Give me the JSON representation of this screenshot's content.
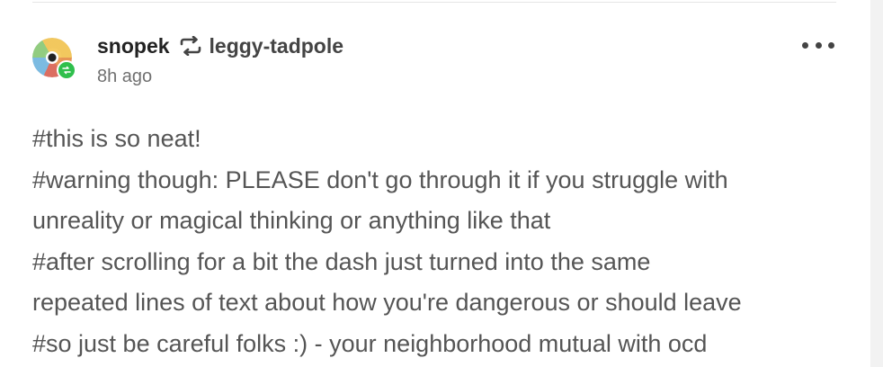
{
  "post": {
    "author": "snopek",
    "reblogged_from": "leggy-tadpole",
    "timestamp": "8h ago",
    "tags": [
      "#this is so neat!",
      "#warning though: PLEASE don't go through it if you struggle with",
      "unreality or magical thinking or anything like that",
      "#after scrolling for a bit the dash just turned into the same",
      "repeated lines of text about how you're dangerous or should leave",
      "#so just be careful folks :) - your neighborhood mutual with ocd"
    ]
  },
  "icons": {
    "reblog": "reblog-icon",
    "more": "more-options-icon",
    "badge": "reblog-badge-icon"
  },
  "colors": {
    "reblog_green": "#2fbf4c",
    "text_primary": "#222222",
    "text_secondary": "#707070",
    "tag_text": "#555555"
  }
}
